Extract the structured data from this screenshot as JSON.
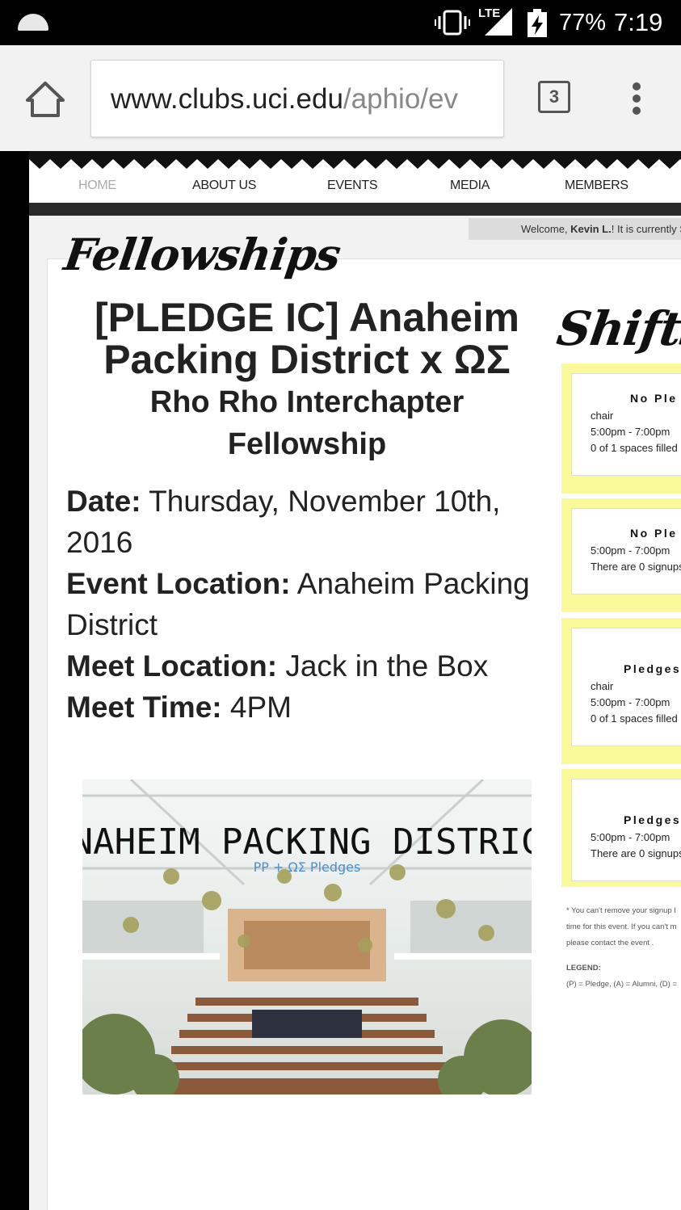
{
  "status_bar": {
    "battery": "77%",
    "time": "7:19",
    "network": "LTE",
    "icons": [
      "notification-icon",
      "vibrate-icon",
      "signal-icon",
      "battery-charging-icon"
    ]
  },
  "browser": {
    "url_domain": "www.clubs.uci.edu",
    "url_path": "/aphio/ev",
    "tab_count": "3",
    "icons": [
      "home-icon",
      "tabs-icon",
      "overflow-menu-icon"
    ]
  },
  "nav": {
    "items": [
      "HOME",
      "ABOUT US",
      "EVENTS",
      "MEDIA",
      "MEMBERS"
    ]
  },
  "welcome": {
    "prefix": "Welcome, ",
    "name": "Kevin L.",
    "suffix": "! It is currently S"
  },
  "section": {
    "heading": "Fellowships",
    "shifts_heading": "Shifts"
  },
  "event": {
    "title_line1": "[PLEDGE IC] Anaheim",
    "title_line2": "Packing District x ΩΣ",
    "subtitle_line1": "Rho Rho Interchapter",
    "subtitle_line2": "Fellowship",
    "date_label": "Date:",
    "date_value": "Thursday, November 10th, 2016",
    "location_label": "Event Location:",
    "location_value": "Anaheim Packing District",
    "meet_label": "Meet Location:",
    "meet_value": "Jack in the Box",
    "time_label": "Meet Time:",
    "time_value": "4PM"
  },
  "image": {
    "title": "ANAHEIM PACKING DISTRICT",
    "caption": "PP + ΩΣ Pledges"
  },
  "shifts": [
    {
      "title": "No Ple",
      "role": "chair",
      "time": "5:00pm - 7:00pm",
      "status": "0 of 1 spaces filled"
    },
    {
      "title": "No Ple",
      "role": "",
      "time": "5:00pm - 7:00pm",
      "status": "There are 0 signups"
    },
    {
      "title": "Pledges",
      "role": "chair",
      "time": "5:00pm - 7:00pm",
      "status": "0 of 1 spaces filled"
    },
    {
      "title": "Pledges",
      "role": "",
      "time": "5:00pm - 7:00pm",
      "status": "There are 0 signups"
    }
  ],
  "notes": {
    "line1": "* You can't remove your signup l",
    "line2": "time for this event. If you can't m",
    "line3": "please contact the event .",
    "legend_label": "LEGEND:",
    "legend_text": "(P) = Pledge, (A) = Alumni, (D) ="
  }
}
